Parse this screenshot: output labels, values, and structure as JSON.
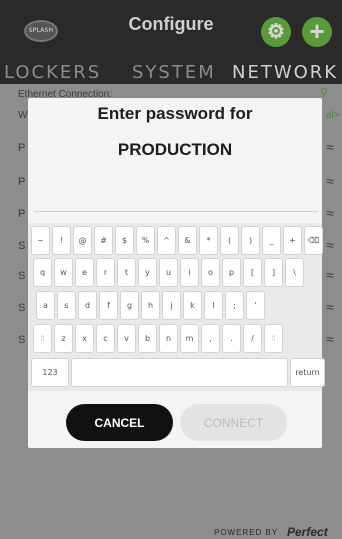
{
  "header": {
    "logo_text": "SPLASH",
    "title": "Configure",
    "gear_icon": "gear-icon",
    "plus_icon": "plus-icon",
    "accent_color": "#5a9a3a"
  },
  "tabs": [
    {
      "label": "LOCKERS",
      "active": false
    },
    {
      "label": "SYSTEM",
      "active": false
    },
    {
      "label": "NETWORK",
      "active": true
    }
  ],
  "network": {
    "ethernet_label": "Ethernet Connection:",
    "ethernet_sub": "W",
    "ethernet_link": "al>",
    "rows": [
      {
        "label": "P",
        "icon": "wifi-icon"
      },
      {
        "label": "P",
        "icon": "wifi-icon"
      },
      {
        "label": "P",
        "icon": "wifi-icon"
      },
      {
        "label": "S",
        "icon": "wifi-icon"
      },
      {
        "label": "S",
        "icon": "wifi-icon"
      },
      {
        "label": "S",
        "icon": "wifi-icon"
      },
      {
        "label": "S",
        "icon": "wifi-icon"
      }
    ]
  },
  "dialog": {
    "prompt": "Enter password for",
    "ssid": "PRODUCTION",
    "password_value": "",
    "cancel_label": "CANCEL",
    "connect_label": "CONNECT"
  },
  "keyboard": {
    "row1": [
      "~",
      "!",
      "@",
      "#",
      "$",
      "%",
      "^",
      "&",
      "*",
      "(",
      ")",
      "_",
      "+",
      "⌫"
    ],
    "row2": [
      "q",
      "w",
      "e",
      "r",
      "t",
      "y",
      "u",
      "i",
      "o",
      "p",
      "[",
      "]",
      "\\"
    ],
    "row3": [
      "a",
      "s",
      "d",
      "f",
      "g",
      "h",
      "j",
      "k",
      "l",
      ";",
      "'"
    ],
    "row4": [
      "⇧",
      "z",
      "x",
      "c",
      "v",
      "b",
      "n",
      "m",
      ",",
      ".",
      "/",
      "⇧"
    ],
    "mode_key": "123",
    "return_key": "return"
  },
  "footer": {
    "powered_text": "POWERED BY",
    "brand": "Perfect"
  }
}
